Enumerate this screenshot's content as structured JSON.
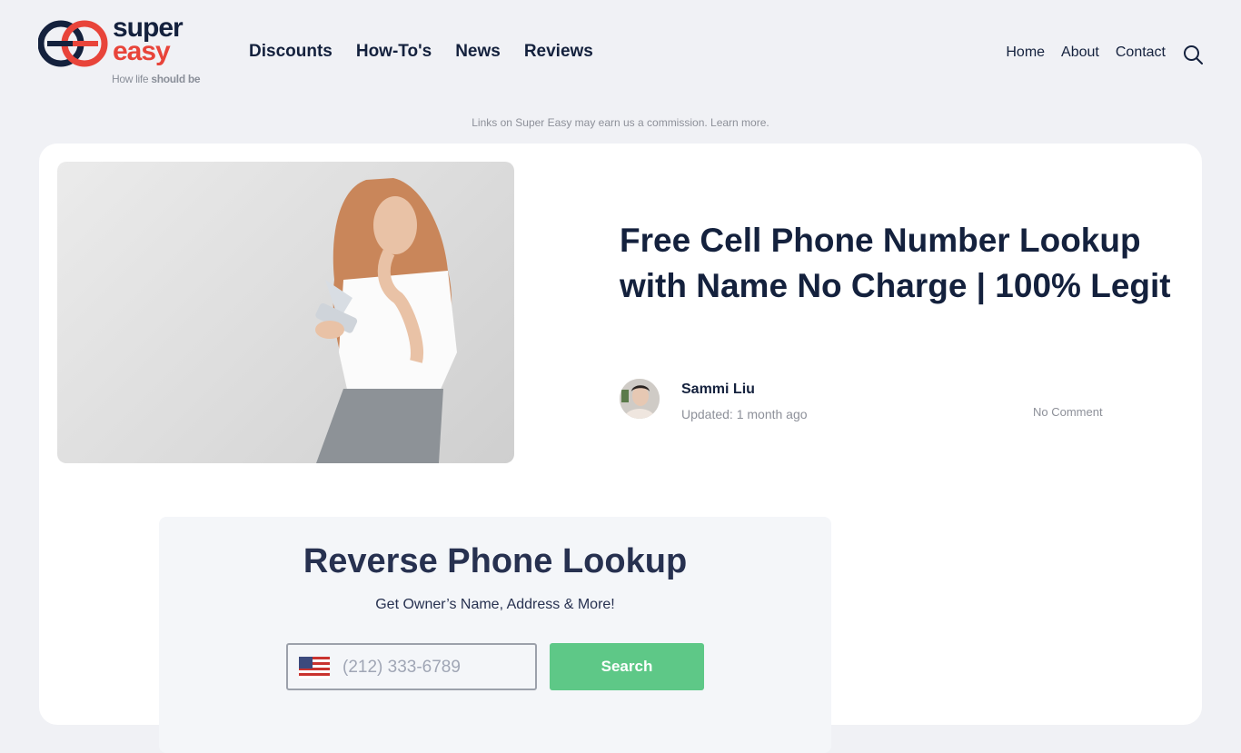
{
  "brand": {
    "name_line1": "super",
    "name_line2": "easy",
    "tagline_prefix": "How life ",
    "tagline_bold": "should be",
    "colors": {
      "navy": "#14213d",
      "red": "#e8443a"
    }
  },
  "main_nav": [
    {
      "label": "Discounts"
    },
    {
      "label": "How-To's"
    },
    {
      "label": "News"
    },
    {
      "label": "Reviews"
    }
  ],
  "util_nav": [
    {
      "label": "Home"
    },
    {
      "label": "About"
    },
    {
      "label": "Contact"
    }
  ],
  "search_icon": "search-icon",
  "disclaimer": "Links on Super Easy may earn us a commission. Learn more.",
  "article": {
    "title": "Free Cell Phone Number Lookup with Name No Charge | 100% Legit",
    "hero_image": "woman-thinking-holding-phone",
    "author": "Sammi Liu",
    "updated": "Updated: 1 month ago",
    "comments": "No Comment"
  },
  "lookup_widget": {
    "title": "Reverse Phone Lookup",
    "subtitle": "Get Owner’s Name, Address & More!",
    "phone_placeholder": "(212) 333-6789",
    "phone_value": "",
    "country_flag": "us-flag-icon",
    "search_label": "Search",
    "button_color": "#5ec887"
  }
}
